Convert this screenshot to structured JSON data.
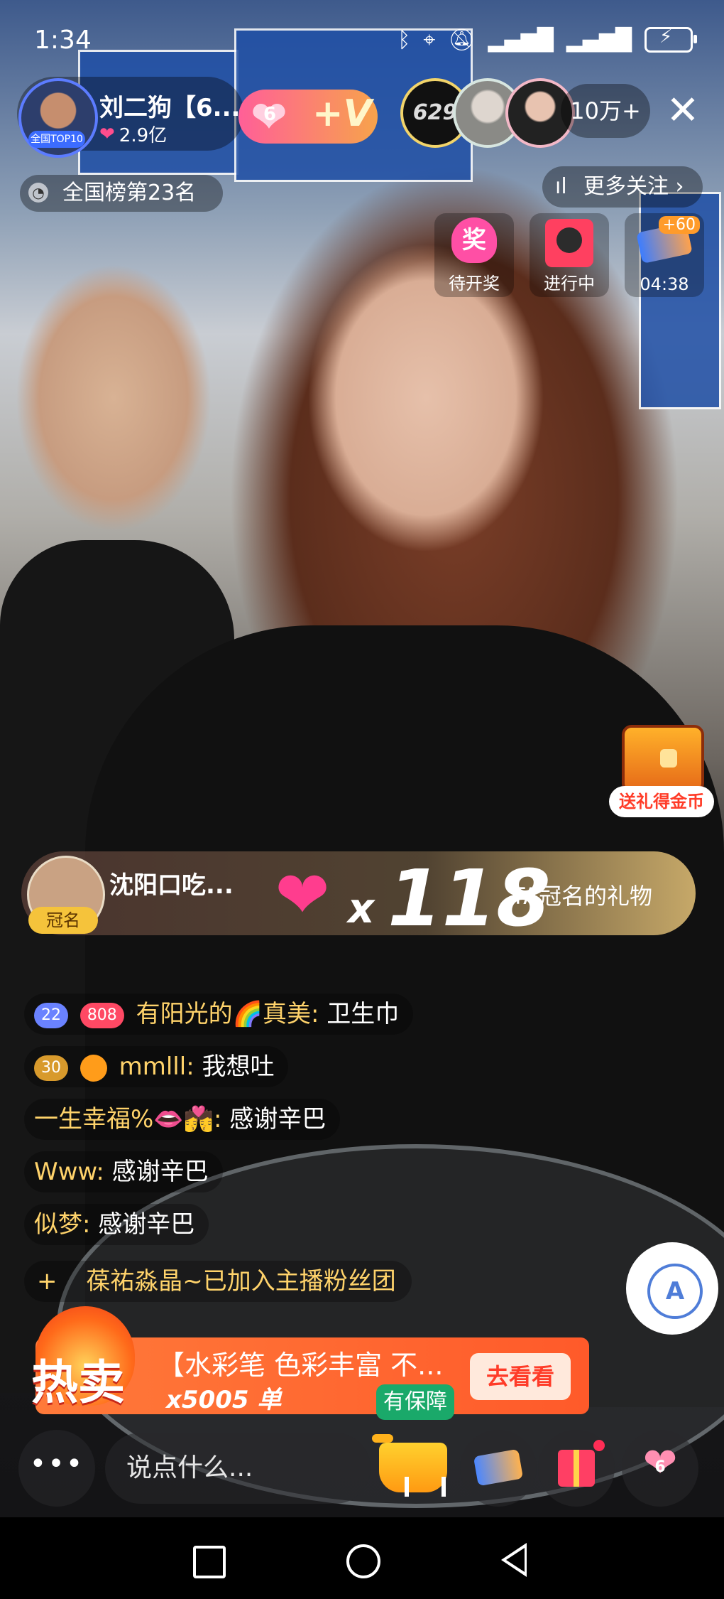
{
  "status_bar": {
    "time": "1:34",
    "icons": [
      "bluetooth-icon",
      "location-icon",
      "mute-icon",
      "signal-icon",
      "signal-icon",
      "battery-icon"
    ]
  },
  "anchor": {
    "name": "刘二狗【6...",
    "likes": "2.9亿",
    "top_badge": "全国TOP10",
    "fan_level": "6"
  },
  "viewers": {
    "first_avatar_label": "629",
    "count": "10万+"
  },
  "rank": {
    "text": "全国榜第23名"
  },
  "more_follow": {
    "label": "更多关注 ›"
  },
  "activity_tiles": [
    {
      "icon_text": "奖",
      "label": "待开奖"
    },
    {
      "label": "进行中"
    },
    {
      "badge": "+60",
      "label": "04:38"
    }
  ],
  "treasure": {
    "label": "送礼得金币"
  },
  "gift_banner": {
    "sender": "沈阳口吃...",
    "sender_badge": "冠名",
    "multiplier_prefix": "x",
    "count": "118",
    "named_text": "TA冠名的礼物"
  },
  "comments": [
    {
      "badges": [
        "22",
        "808"
      ],
      "user": "有阳光的🌈真美:",
      "text": "卫生巾"
    },
    {
      "badges": [
        "30"
      ],
      "user": "mmlll:",
      "text": "我想吐"
    },
    {
      "user": "一生幸福%👄💏:",
      "text": "感谢辛巴"
    },
    {
      "user": "Www:",
      "text": "感谢辛巴"
    },
    {
      "user": "似梦:",
      "text": "感谢辛巴"
    }
  ],
  "fans_notice": {
    "prefix": "+",
    "text": "葆祐淼晶~已加入主播粉丝团"
  },
  "hot_sale": {
    "badge": "热卖",
    "title": "【水彩笔 色彩丰富 不...",
    "sold": "x5005 单",
    "button": "去看看",
    "guarantee": "有保障"
  },
  "bottom_bar": {
    "more": "•••",
    "input_placeholder": "说点什么...",
    "heart_count": "6"
  },
  "colors": {
    "accent_gold": "#ffd36b",
    "hot_orange": "#ff5a2a",
    "gift_pink": "#ff3d8e"
  }
}
